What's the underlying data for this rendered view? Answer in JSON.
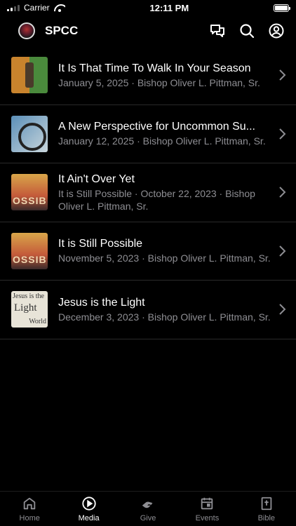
{
  "status_bar": {
    "carrier": "Carrier",
    "time": "12:11 PM",
    "battery_level": 1.0
  },
  "header": {
    "title": "SPCC",
    "icons": [
      "chat-icon",
      "search-icon",
      "account-icon"
    ]
  },
  "items": [
    {
      "title": "It Is That Time To Walk In Your Season",
      "meta": "January 5, 2025 · Bishop Oliver L. Pittman, Sr.",
      "thumb": "autumn-tree"
    },
    {
      "title": "A New Perspective for Uncommon Su...",
      "meta": "January 12, 2025 · Bishop Oliver L. Pittman, Sr.",
      "thumb": "lens"
    },
    {
      "title": "It Ain't Over Yet",
      "meta": "It is Still Possible · October 22, 2023 · Bishop Oliver L. Pittman, Sr.",
      "thumb": "possible"
    },
    {
      "title": "It is Still Possible",
      "meta": "November 5, 2023 · Bishop Oliver L. Pittman, Sr.",
      "thumb": "possible"
    },
    {
      "title": "Jesus is the Light",
      "meta": "December 3, 2023 · Bishop Oliver L. Pittman, Sr.",
      "thumb": "jesus-light"
    }
  ],
  "thumb_text": {
    "possible": "OSSIB",
    "jesus_a": "Jesus  is the",
    "jesus_b": "Light",
    "jesus_c": "World"
  },
  "tabs": [
    {
      "label": "Home",
      "icon": "home-icon",
      "active": false
    },
    {
      "label": "Media",
      "icon": "play-icon",
      "active": true
    },
    {
      "label": "Give",
      "icon": "give-icon",
      "active": false
    },
    {
      "label": "Events",
      "icon": "calendar-icon",
      "active": false
    },
    {
      "label": "Bible",
      "icon": "bible-icon",
      "active": false
    }
  ]
}
